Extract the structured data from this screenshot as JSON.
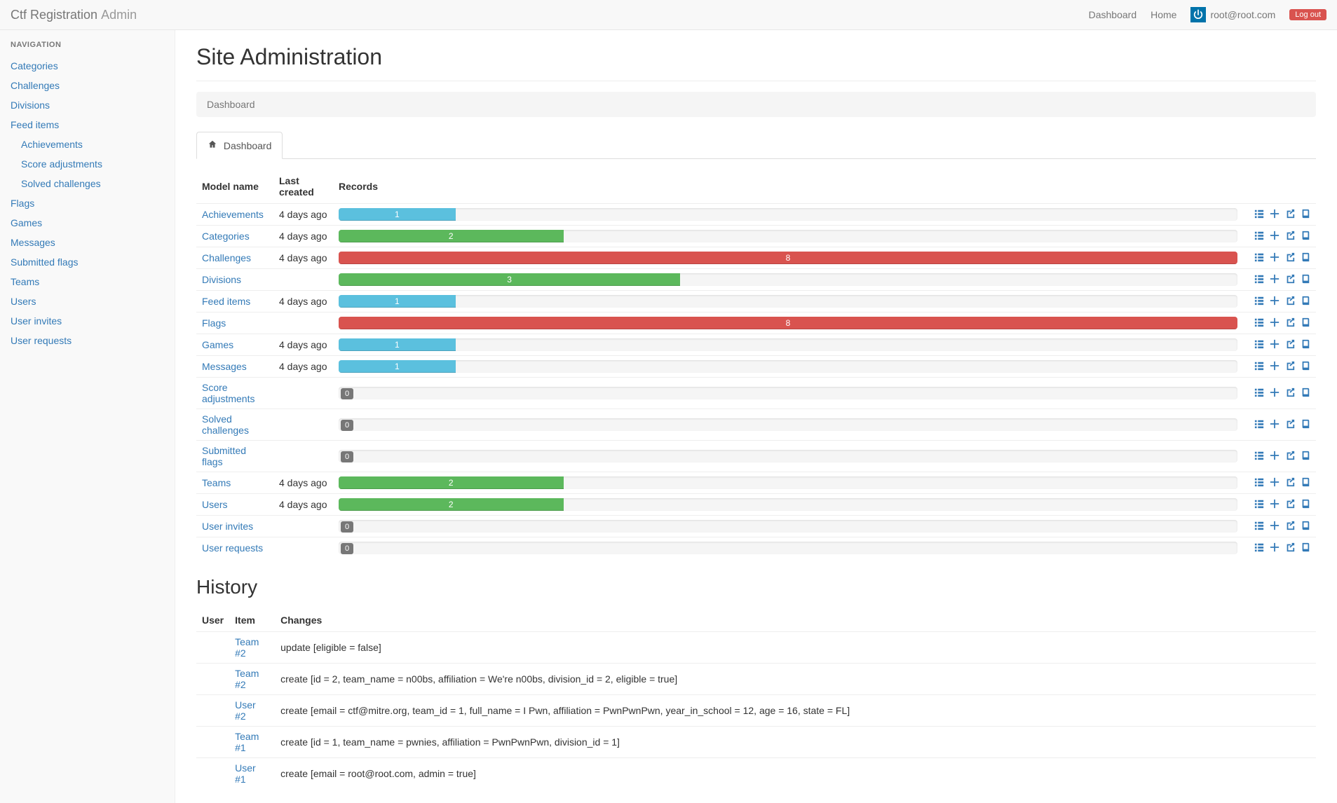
{
  "header": {
    "brand": "Ctf Registration",
    "brand_sub": "Admin",
    "nav": {
      "dashboard": "Dashboard",
      "home": "Home"
    },
    "user_email": "root@root.com",
    "logout": "Log out"
  },
  "sidebar": {
    "heading": "NAVIGATION",
    "items": [
      {
        "label": "Categories",
        "sub": false
      },
      {
        "label": "Challenges",
        "sub": false
      },
      {
        "label": "Divisions",
        "sub": false
      },
      {
        "label": "Feed items",
        "sub": false
      },
      {
        "label": "Achievements",
        "sub": true
      },
      {
        "label": "Score adjustments",
        "sub": true
      },
      {
        "label": "Solved challenges",
        "sub": true
      },
      {
        "label": "Flags",
        "sub": false
      },
      {
        "label": "Games",
        "sub": false
      },
      {
        "label": "Messages",
        "sub": false
      },
      {
        "label": "Submitted flags",
        "sub": false
      },
      {
        "label": "Teams",
        "sub": false
      },
      {
        "label": "Users",
        "sub": false
      },
      {
        "label": "User invites",
        "sub": false
      },
      {
        "label": "User requests",
        "sub": false
      }
    ]
  },
  "page": {
    "title": "Site Administration",
    "breadcrumb": "Dashboard",
    "tab_label": "Dashboard",
    "history_title": "History"
  },
  "table": {
    "headers": {
      "model": "Model name",
      "last": "Last created",
      "records": "Records"
    },
    "max_records": 8,
    "rows": [
      {
        "name": "Achievements",
        "last": "4 days ago",
        "count": 1,
        "color": "blue"
      },
      {
        "name": "Categories",
        "last": "4 days ago",
        "count": 2,
        "color": "green"
      },
      {
        "name": "Challenges",
        "last": "4 days ago",
        "count": 8,
        "color": "red"
      },
      {
        "name": "Divisions",
        "last": "",
        "count": 3,
        "color": "green"
      },
      {
        "name": "Feed items",
        "last": "4 days ago",
        "count": 1,
        "color": "blue"
      },
      {
        "name": "Flags",
        "last": "",
        "count": 8,
        "color": "red"
      },
      {
        "name": "Games",
        "last": "4 days ago",
        "count": 1,
        "color": "blue"
      },
      {
        "name": "Messages",
        "last": "4 days ago",
        "count": 1,
        "color": "blue"
      },
      {
        "name": "Score adjustments",
        "last": "",
        "count": 0,
        "color": "grey"
      },
      {
        "name": "Solved challenges",
        "last": "",
        "count": 0,
        "color": "grey"
      },
      {
        "name": "Submitted flags",
        "last": "",
        "count": 0,
        "color": "grey"
      },
      {
        "name": "Teams",
        "last": "4 days ago",
        "count": 2,
        "color": "green"
      },
      {
        "name": "Users",
        "last": "4 days ago",
        "count": 2,
        "color": "green"
      },
      {
        "name": "User invites",
        "last": "",
        "count": 0,
        "color": "grey"
      },
      {
        "name": "User requests",
        "last": "",
        "count": 0,
        "color": "grey"
      }
    ]
  },
  "history": {
    "headers": {
      "user": "User",
      "item": "Item",
      "changes": "Changes"
    },
    "rows": [
      {
        "user": "",
        "item": "Team #2",
        "changes": "update [eligible = false]"
      },
      {
        "user": "",
        "item": "Team #2",
        "changes": "create [id = 2, team_name = n00bs, affiliation = We're n00bs, division_id = 2, eligible = true]"
      },
      {
        "user": "",
        "item": "User #2",
        "changes": "create [email = ctf@mitre.org, team_id = 1, full_name = I Pwn, affiliation = PwnPwnPwn, year_in_school = 12, age = 16, state = FL]"
      },
      {
        "user": "",
        "item": "Team #1",
        "changes": "create [id = 1, team_name = pwnies, affiliation = PwnPwnPwn, division_id = 1]"
      },
      {
        "user": "",
        "item": "User #1",
        "changes": "create [email = root@root.com, admin = true]"
      }
    ]
  }
}
